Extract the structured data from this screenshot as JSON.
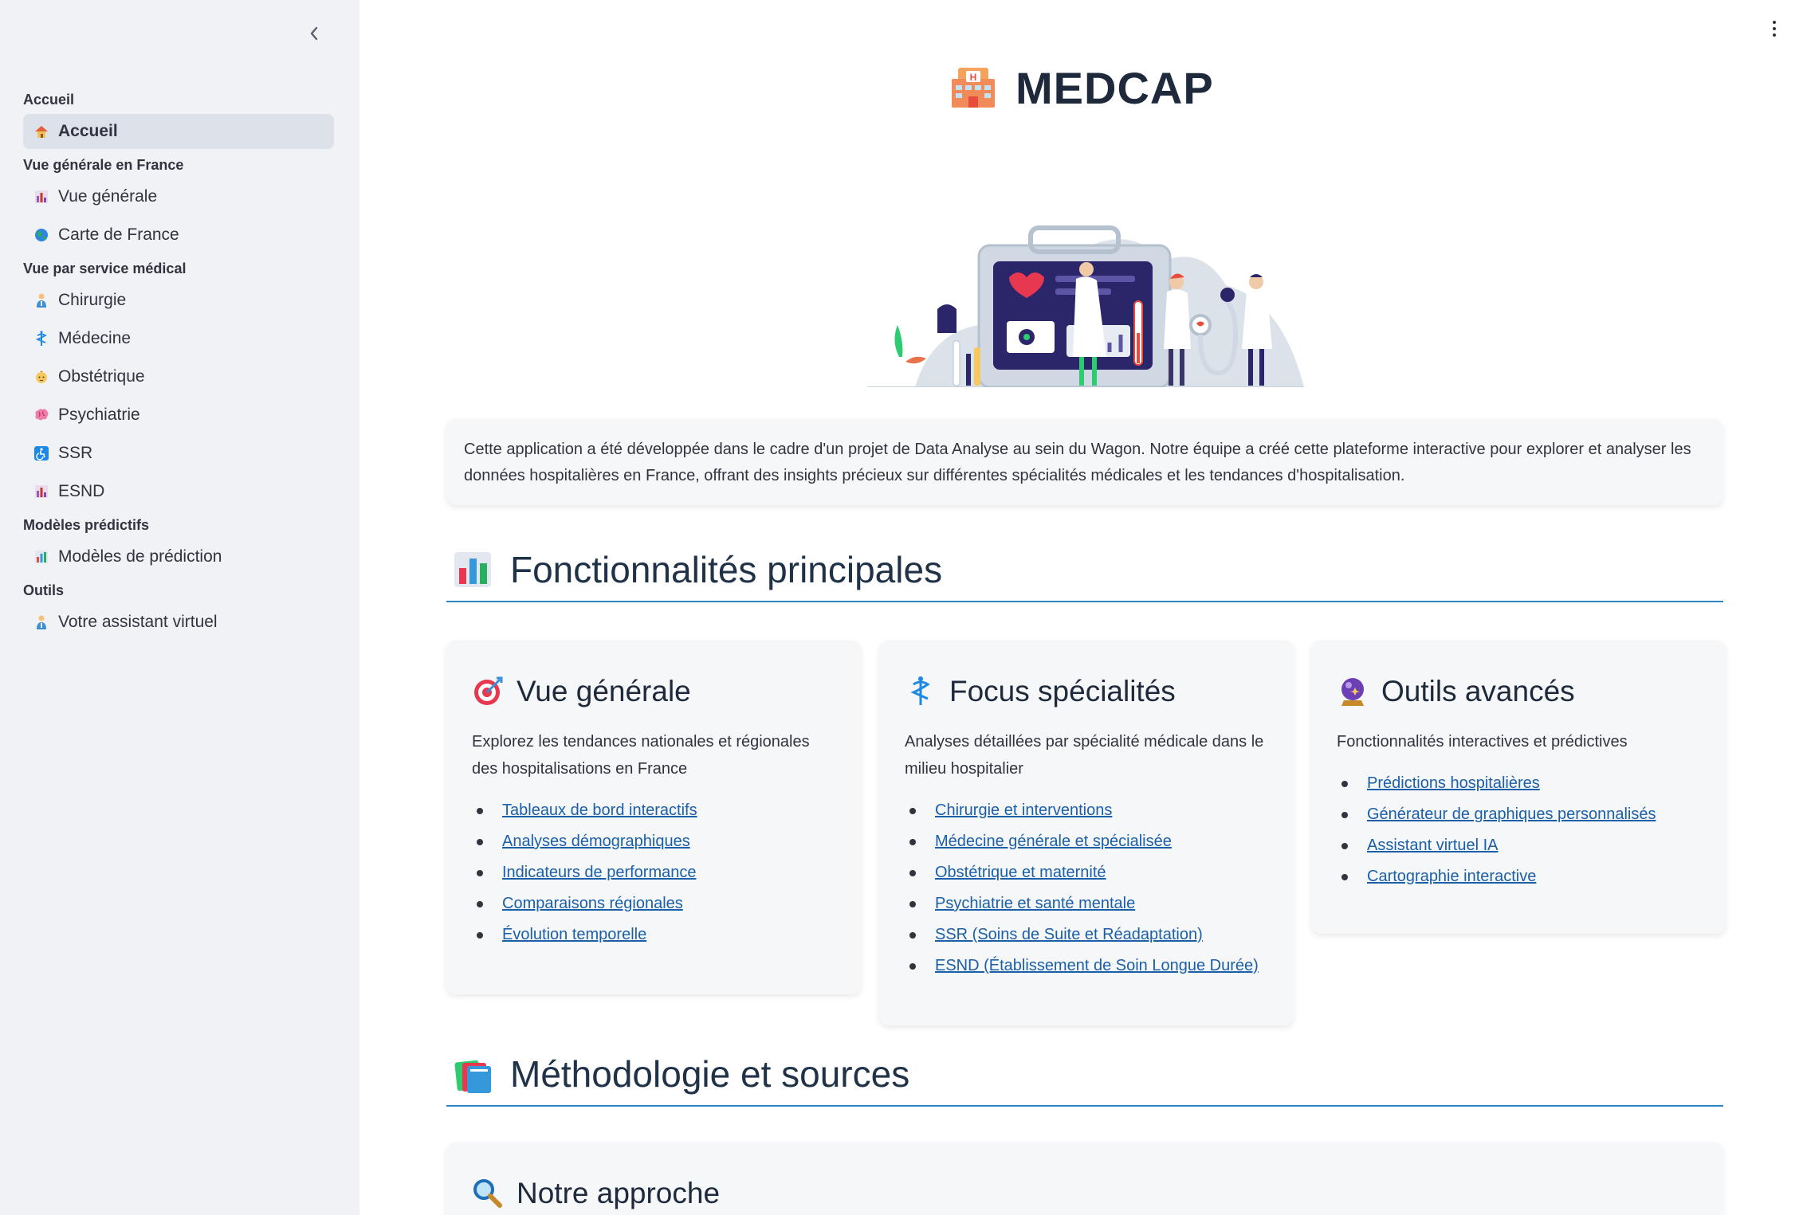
{
  "sidebar": {
    "collapse_icon": "chevron-left-icon",
    "sections": [
      {
        "title": "Accueil",
        "items": [
          {
            "label": "Accueil",
            "icon": "house-icon",
            "active": true
          }
        ]
      },
      {
        "title": "Vue générale en France",
        "items": [
          {
            "label": "Vue générale",
            "icon": "bar-chart-icon"
          },
          {
            "label": "Carte de France",
            "icon": "globe-icon"
          }
        ]
      },
      {
        "title": "Vue par service médical",
        "items": [
          {
            "label": "Chirurgie",
            "icon": "health-worker-icon"
          },
          {
            "label": "Médecine",
            "icon": "medical-symbol-icon"
          },
          {
            "label": "Obstétrique",
            "icon": "baby-icon"
          },
          {
            "label": "Psychiatrie",
            "icon": "brain-icon"
          },
          {
            "label": "SSR",
            "icon": "wheelchair-icon"
          },
          {
            "label": "ESND",
            "icon": "bar-chart-icon"
          }
        ]
      },
      {
        "title": "Modèles prédictifs",
        "items": [
          {
            "label": "Modèles de prédiction",
            "icon": "bar-chart-icon"
          }
        ]
      },
      {
        "title": "Outils",
        "items": [
          {
            "label": "Votre assistant virtuel",
            "icon": "health-worker-icon"
          }
        ]
      }
    ]
  },
  "header": {
    "title": "MEDCAP",
    "icon": "hospital-icon",
    "menu_icon": "kebab-menu-icon"
  },
  "hero": {
    "icon": "medical-illustration"
  },
  "intro": {
    "text": "Cette application a été développée dans le cadre d'un projet de Data Analyse au sein du Wagon. Notre équipe a créé cette plateforme interactive pour explorer et analyser les données hospitalières en France, offrant des insights précieux sur différentes spécialités médicales et les tendances d'hospitalisation."
  },
  "features": {
    "title": "Fonctionnalités principales",
    "icon": "bar-chart-icon",
    "cards": [
      {
        "title": "Vue générale",
        "icon": "target-icon",
        "description": "Explorez les tendances nationales et régionales des hospitalisations en France",
        "links": [
          "Tableaux de bord interactifs",
          "Analyses démographiques",
          "Indicateurs de performance",
          "Comparaisons régionales",
          "Évolution temporelle"
        ]
      },
      {
        "title": "Focus spécialités",
        "icon": "medical-symbol-icon",
        "description": "Analyses détaillées par spécialité médicale dans le milieu hospitalier",
        "links": [
          "Chirurgie et interventions",
          "Médecine générale et spécialisée",
          "Obstétrique et maternité",
          "Psychiatrie et santé mentale",
          "SSR (Soins de Suite et Réadaptation)",
          "ESND (Établissement de Soin Longue Durée)"
        ]
      },
      {
        "title": "Outils avancés",
        "icon": "crystal-ball-icon",
        "description": "Fonctionnalités interactives et prédictives",
        "links": [
          "Prédictions hospitalières",
          "Générateur de graphiques personnalisés",
          "Assistant virtuel IA",
          "Cartographie interactive"
        ]
      }
    ]
  },
  "methodology": {
    "title": "Méthodologie et sources",
    "icon": "books-icon",
    "approach_title": "Notre approche",
    "approach_icon": "magnifier-icon"
  },
  "colors": {
    "accent_line": "#2e86c1",
    "link": "#1a5fa8",
    "sidebar_bg": "#f0f2f6"
  }
}
